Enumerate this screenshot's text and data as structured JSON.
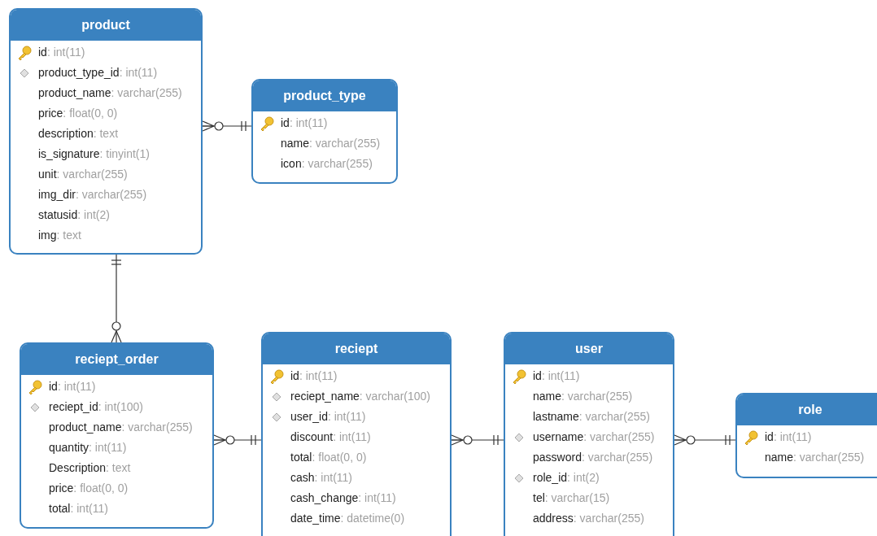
{
  "tables": [
    {
      "title": "product",
      "columns": [
        {
          "kind": "pk",
          "name": "id",
          "type": ": int(11)"
        },
        {
          "kind": "fk",
          "name": "product_type_id",
          "type": ": int(11)"
        },
        {
          "kind": "plain",
          "name": "product_name",
          "type": ": varchar(255)"
        },
        {
          "kind": "plain",
          "name": "price",
          "type": ": float(0, 0)"
        },
        {
          "kind": "plain",
          "name": "description",
          "type": ": text"
        },
        {
          "kind": "plain",
          "name": "is_signature",
          "type": ": tinyint(1)"
        },
        {
          "kind": "plain",
          "name": "unit",
          "type": ": varchar(255)"
        },
        {
          "kind": "plain",
          "name": "img_dir",
          "type": ": varchar(255)"
        },
        {
          "kind": "plain",
          "name": "statusid",
          "type": ": int(2)"
        },
        {
          "kind": "plain",
          "name": "img",
          "type": ": text"
        }
      ]
    },
    {
      "title": "product_type",
      "columns": [
        {
          "kind": "pk",
          "name": "id",
          "type": ": int(11)"
        },
        {
          "kind": "plain",
          "name": "name",
          "type": ": varchar(255)"
        },
        {
          "kind": "plain",
          "name": "icon",
          "type": ": varchar(255)"
        }
      ]
    },
    {
      "title": "reciept_order",
      "columns": [
        {
          "kind": "pk",
          "name": "id",
          "type": ": int(11)"
        },
        {
          "kind": "fk",
          "name": "reciept_id",
          "type": ": int(100)"
        },
        {
          "kind": "plain",
          "name": "product_name",
          "type": ": varchar(255)"
        },
        {
          "kind": "plain",
          "name": "quantity",
          "type": ": int(11)"
        },
        {
          "kind": "plain",
          "name": "Description",
          "type": ": text"
        },
        {
          "kind": "plain",
          "name": "price",
          "type": ": float(0, 0)"
        },
        {
          "kind": "plain",
          "name": "total",
          "type": ": int(11)"
        }
      ]
    },
    {
      "title": "reciept",
      "columns": [
        {
          "kind": "pk",
          "name": "id",
          "type": ": int(11)"
        },
        {
          "kind": "fk",
          "name": "reciept_name",
          "type": ": varchar(100)"
        },
        {
          "kind": "fk",
          "name": "user_id",
          "type": ": int(11)"
        },
        {
          "kind": "plain",
          "name": "discount",
          "type": ": int(11)"
        },
        {
          "kind": "plain",
          "name": "total",
          "type": ": float(0, 0)"
        },
        {
          "kind": "plain",
          "name": "cash",
          "type": ": int(11)"
        },
        {
          "kind": "plain",
          "name": "cash_change",
          "type": ": int(11)"
        },
        {
          "kind": "plain",
          "name": "date_time",
          "type": ": datetime(0)"
        }
      ]
    },
    {
      "title": "user",
      "columns": [
        {
          "kind": "pk",
          "name": "id",
          "type": ": int(11)"
        },
        {
          "kind": "plain",
          "name": "name",
          "type": ": varchar(255)"
        },
        {
          "kind": "plain",
          "name": "lastname",
          "type": ": varchar(255)"
        },
        {
          "kind": "fk",
          "name": "username",
          "type": ": varchar(255)"
        },
        {
          "kind": "plain",
          "name": "password",
          "type": ": varchar(255)"
        },
        {
          "kind": "fk",
          "name": "role_id",
          "type": ": int(2)"
        },
        {
          "kind": "plain",
          "name": "tel",
          "type": ": varchar(15)"
        },
        {
          "kind": "plain",
          "name": "address",
          "type": ": varchar(255)"
        }
      ]
    },
    {
      "title": "role",
      "columns": [
        {
          "kind": "pk",
          "name": "id",
          "type": ": int(11)"
        },
        {
          "kind": "plain",
          "name": "name",
          "type": ": varchar(255)"
        }
      ]
    }
  ]
}
